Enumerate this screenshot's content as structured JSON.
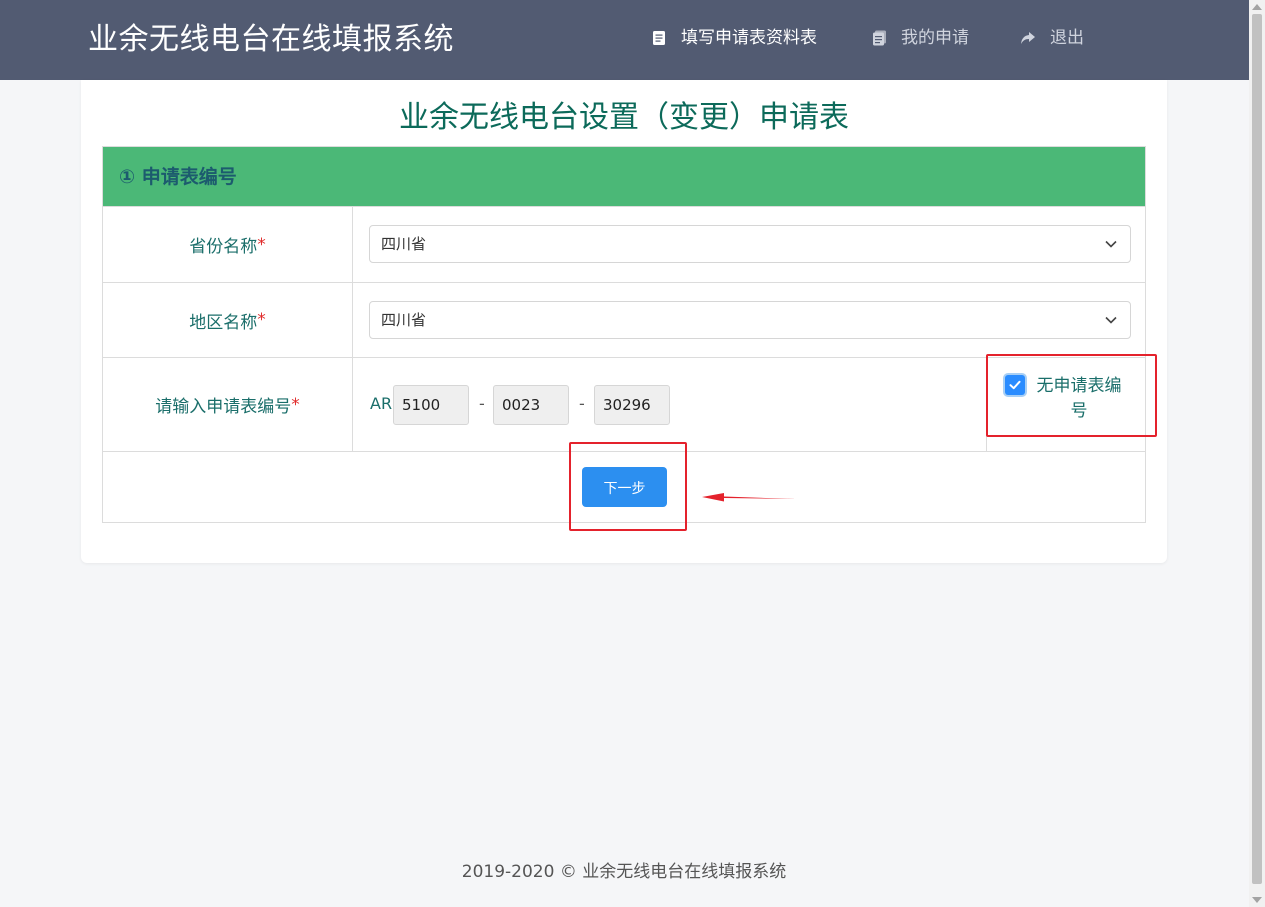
{
  "header": {
    "app_title": "业余无线电台在线填报系统",
    "nav": [
      {
        "label": "填写申请表资料表",
        "icon": "document-icon"
      },
      {
        "label": "我的申请",
        "icon": "documents-icon"
      },
      {
        "label": "退出",
        "icon": "share-arrow-icon"
      }
    ]
  },
  "form": {
    "title": "业余无线电台设置（变更）申请表",
    "section_title": "① 申请表编号",
    "required_mark": "*",
    "province": {
      "label": "省份名称",
      "value": "四川省"
    },
    "region": {
      "label": "地区名称",
      "value": "四川省"
    },
    "code": {
      "label": "请输入申请表编号",
      "prefix": "AR",
      "separator": "-",
      "part1": "5100",
      "part2": "0023",
      "part3": "30296"
    },
    "no_code": {
      "label": "无申请表编号",
      "checked": true
    },
    "next_button": "下一步"
  },
  "footer": {
    "text": "2019-2020 © 业余无线电台在线填报系统"
  },
  "colors": {
    "topbar": "#525b72",
    "section_header": "#4bb877",
    "title_text": "#0c6a5a",
    "label_text": "#1a6e6a",
    "primary_button": "#2c8ff0",
    "highlight": "#e4222c"
  }
}
